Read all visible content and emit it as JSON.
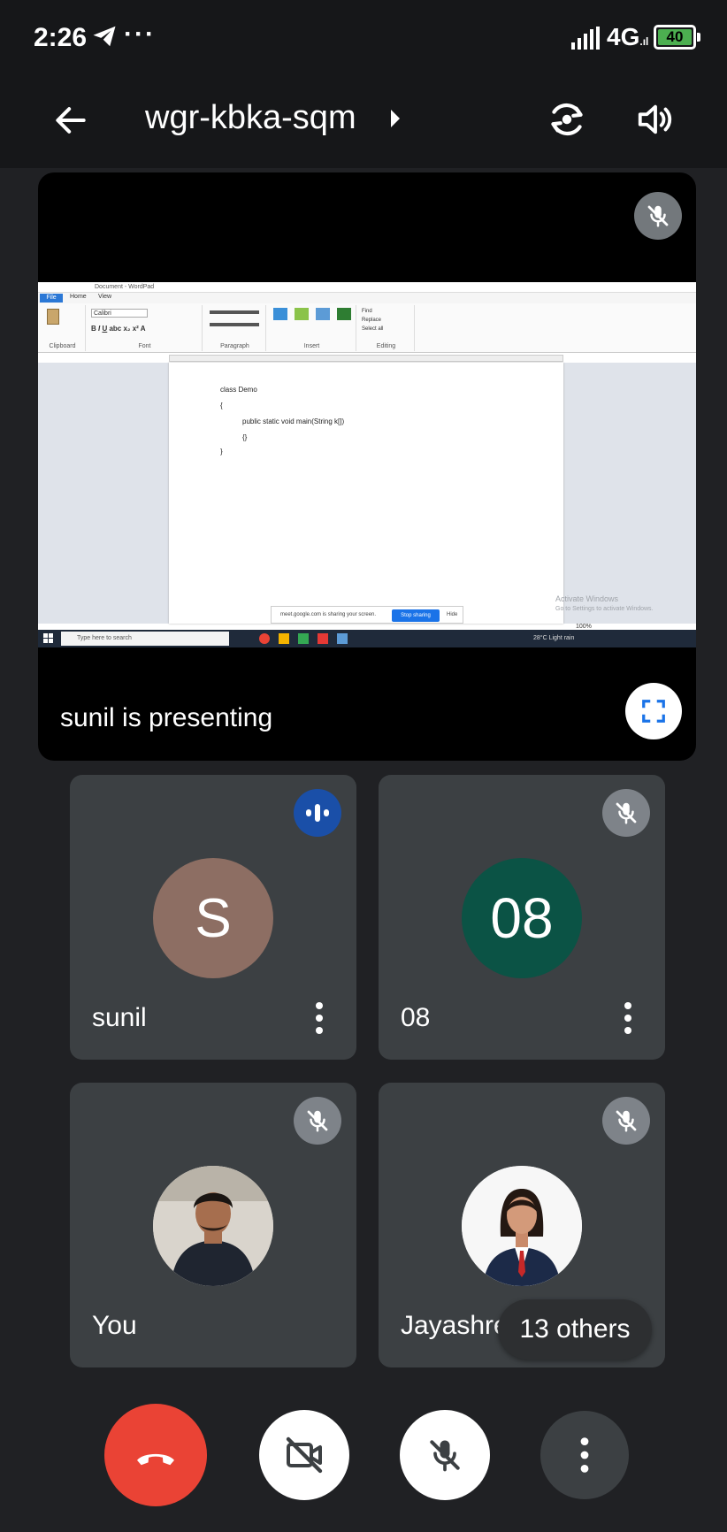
{
  "status_bar": {
    "time": "2:26",
    "more_indicator": "···",
    "network": "4G",
    "battery": "40"
  },
  "header": {
    "meeting_code": "wgr-kbka-sqm",
    "icons": [
      "back-arrow-icon",
      "caret-right-icon",
      "switch-camera-icon",
      "speaker-icon"
    ]
  },
  "presentation": {
    "label": "sunil is presenting",
    "shared_screen": {
      "window_title": "Document - WordPad",
      "tabs": [
        "File",
        "Home",
        "View"
      ],
      "font_name": "Calibri",
      "ribbon_groups": [
        "Clipboard",
        "Font",
        "Paragraph",
        "Insert",
        "Editing"
      ],
      "insert_items": [
        "Picture",
        "Paint drawing",
        "Date and time",
        "Insert object"
      ],
      "editing_items": [
        "Find",
        "Replace",
        "Select all"
      ],
      "code_lines": [
        "class Demo",
        "{",
        "public static void main(String k[])",
        "{}",
        "}"
      ],
      "activate_line1": "Activate Windows",
      "activate_line2": "Go to Settings to activate Windows.",
      "share_notice": "meet.google.com is sharing your screen.",
      "stop_label": "Stop sharing",
      "hide_label": "Hide",
      "taskbar_search": "Type here to search",
      "weather": "28°C Light rain",
      "zoom": "100%"
    }
  },
  "participants": [
    {
      "name": "sunil",
      "initial": "S",
      "avatar_color": "#8d6e63",
      "state": "speaking"
    },
    {
      "name": "08",
      "initial": "08",
      "avatar_color": "#0b5345",
      "state": "muted"
    },
    {
      "name": "You",
      "state": "muted"
    },
    {
      "name": "Jayashree",
      "state": "muted"
    }
  ],
  "others_chip": "13 others",
  "controls": [
    "end-call",
    "camera-off",
    "mic-off",
    "more-options"
  ],
  "colors": {
    "background": "#202124",
    "tile": "#3c4043",
    "end_call": "#ea4335",
    "speaking": "#1a4fa8",
    "accent_blue": "#1a73e8"
  }
}
